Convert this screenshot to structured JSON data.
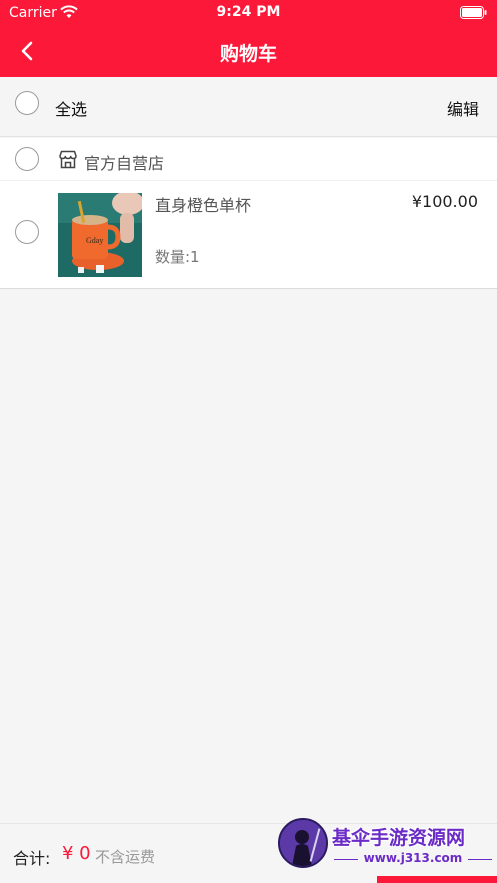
{
  "status_bar": {
    "carrier": "Carrier",
    "time": "9:24 PM"
  },
  "nav": {
    "title": "购物车"
  },
  "select_all": {
    "label": "全选",
    "edit_label": "编辑"
  },
  "store": {
    "name": "官方自营店",
    "items": [
      {
        "name": "直身橙色单杯",
        "price": "¥100.00",
        "quantity": "数量:1"
      }
    ]
  },
  "footer": {
    "total_label": "合计:",
    "total_value": "¥ 0",
    "shipping_note": "不含运费"
  },
  "watermark": {
    "title": "基伞手游资源网",
    "url": "www.j313.com"
  },
  "colors": {
    "brand": "#fb1838",
    "background": "#f5f5f5"
  }
}
